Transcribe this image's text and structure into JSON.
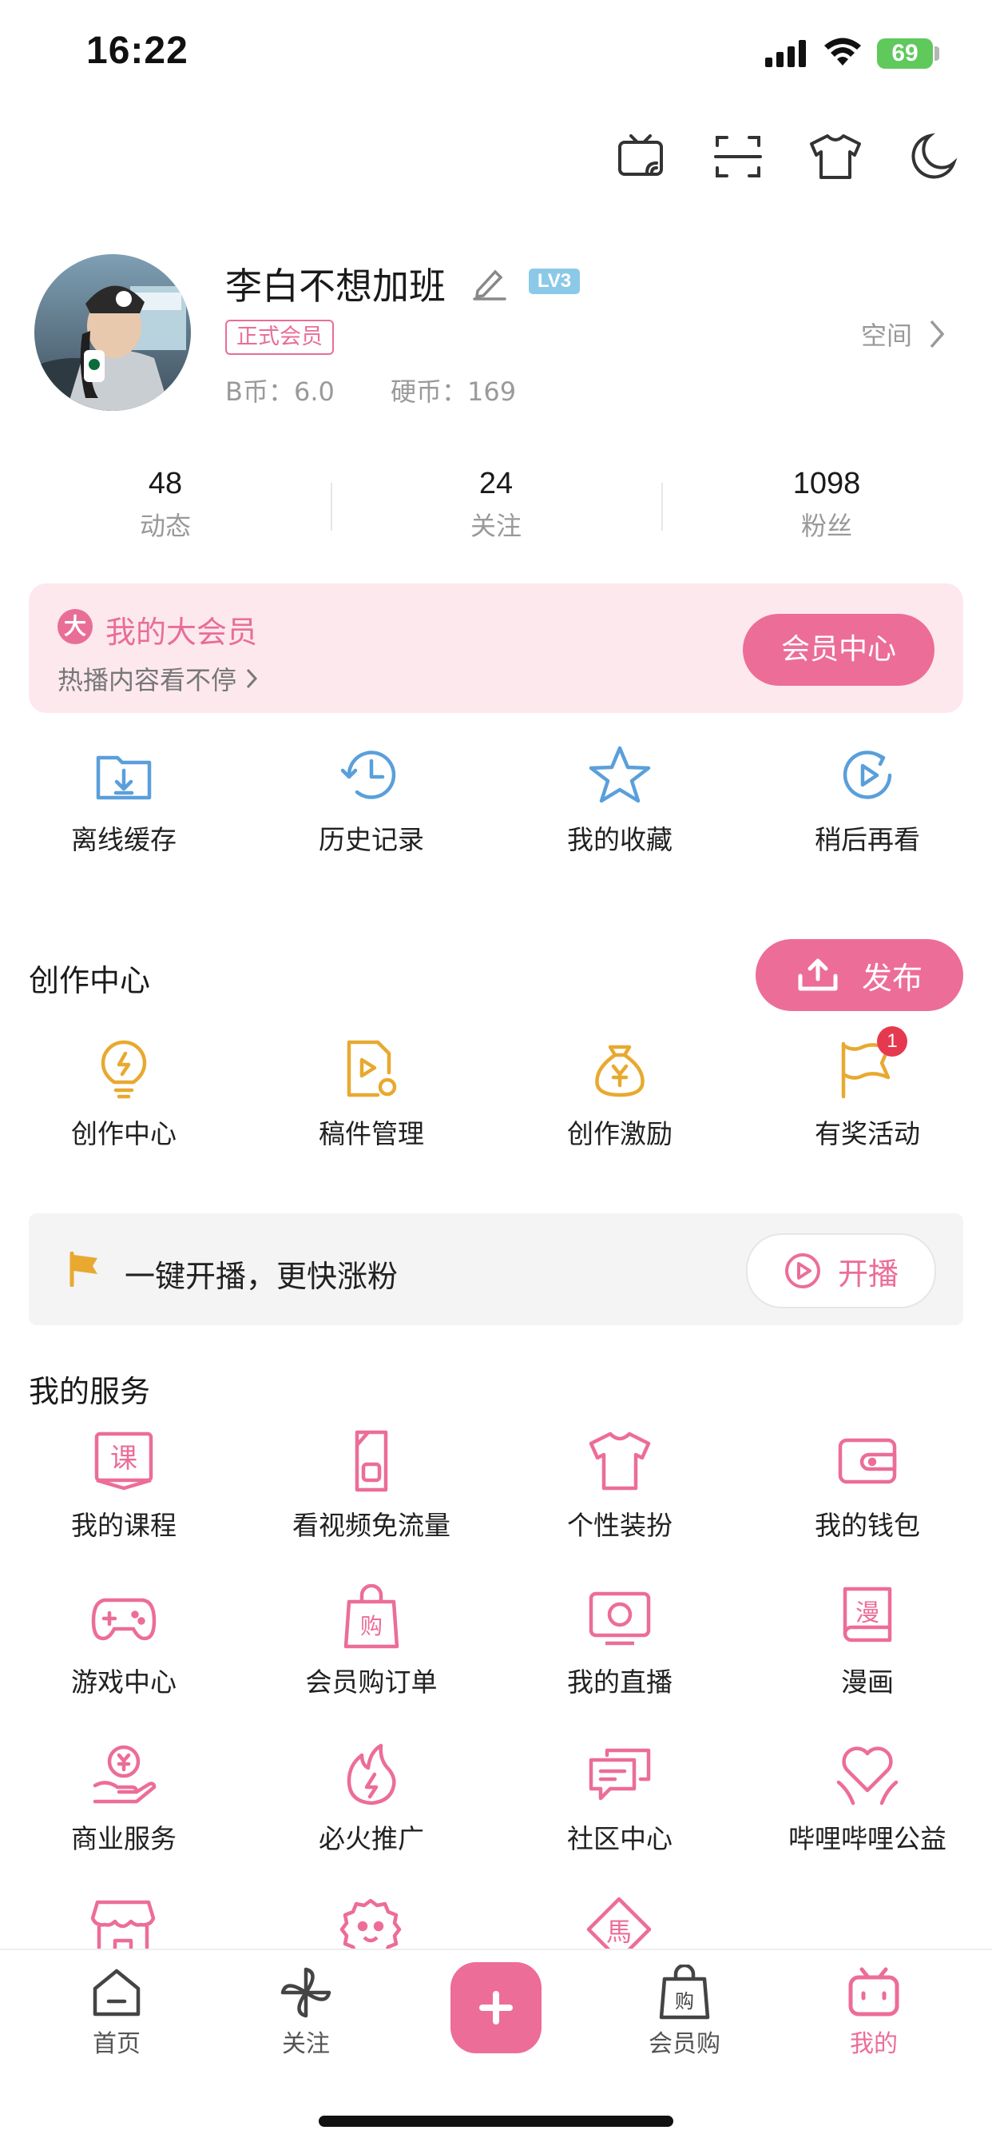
{
  "status_bar": {
    "time": "16:22",
    "battery": "69"
  },
  "profile": {
    "username": "李白不想加班",
    "level": "LV3",
    "member_badge": "正式会员",
    "bcoin": "B币：6.0",
    "coin": "硬币：169",
    "space_label": "空间"
  },
  "stats": [
    {
      "value": "48",
      "label": "动态"
    },
    {
      "value": "24",
      "label": "关注"
    },
    {
      "value": "1098",
      "label": "粉丝"
    }
  ],
  "vip": {
    "icon_char": "大",
    "title": "我的大会员",
    "subtitle": "热播内容看不停",
    "button": "会员中心"
  },
  "quick_tools": [
    {
      "label": "离线缓存",
      "icon": "download-folder-icon"
    },
    {
      "label": "历史记录",
      "icon": "history-icon"
    },
    {
      "label": "我的收藏",
      "icon": "star-icon"
    },
    {
      "label": "稍后再看",
      "icon": "watch-later-icon"
    }
  ],
  "creation": {
    "title": "创作中心",
    "publish_button": "发布",
    "items": [
      {
        "label": "创作中心",
        "icon": "bulb-icon"
      },
      {
        "label": "稿件管理",
        "icon": "manuscript-icon"
      },
      {
        "label": "创作激励",
        "icon": "money-bag-icon"
      },
      {
        "label": "有奖活动",
        "icon": "flag-icon",
        "badge": "1"
      }
    ]
  },
  "live_banner": {
    "text": "一键开播，更快涨粉",
    "button": "开播"
  },
  "services": {
    "title": "我的服务",
    "items": [
      {
        "label": "我的课程",
        "icon": "course-icon"
      },
      {
        "label": "看视频免流量",
        "icon": "sim-card-icon"
      },
      {
        "label": "个性装扮",
        "icon": "tshirt-icon"
      },
      {
        "label": "我的钱包",
        "icon": "wallet-icon"
      },
      {
        "label": "游戏中心",
        "icon": "gamepad-icon"
      },
      {
        "label": "会员购订单",
        "icon": "shopping-bag-icon"
      },
      {
        "label": "我的直播",
        "icon": "live-tv-icon"
      },
      {
        "label": "漫画",
        "icon": "comic-icon"
      },
      {
        "label": "商业服务",
        "icon": "business-hand-icon"
      },
      {
        "label": "必火推广",
        "icon": "fire-icon"
      },
      {
        "label": "社区中心",
        "icon": "chat-bubbles-icon"
      },
      {
        "label": "哔哩哔哩公益",
        "icon": "heart-hands-icon"
      }
    ]
  },
  "tabbar": [
    {
      "label": "首页",
      "icon": "home-icon"
    },
    {
      "label": "关注",
      "icon": "pinwheel-icon"
    },
    {
      "label": "会员购",
      "icon": "shopping-bag-icon"
    },
    {
      "label": "我的",
      "icon": "tv-face-icon",
      "active": true
    }
  ],
  "colors": {
    "accent": "#ec6d98",
    "blue_icon": "#5a9fdb",
    "gold_icon": "#e8a930",
    "vip_bg": "#fde8ee"
  }
}
